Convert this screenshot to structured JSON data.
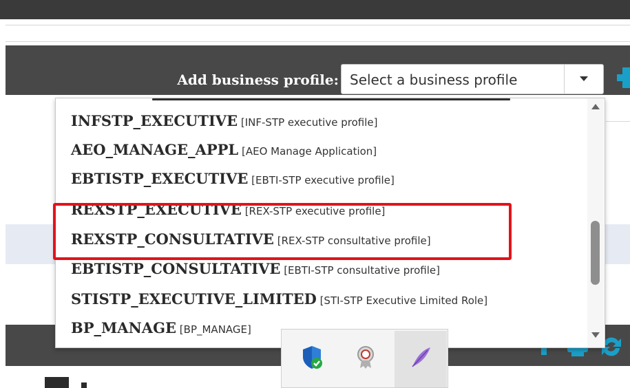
{
  "form": {
    "add_label": "Add business profile:",
    "select_placeholder": "Select a business profile"
  },
  "dropdown": {
    "options": [
      {
        "code": "INFSTP_EXECUTIVE",
        "desc": "[INF-STP executive profile]"
      },
      {
        "code": "AEO_MANAGE_APPL",
        "desc": "[AEO Manage Application]"
      },
      {
        "code": "EBTISTP_EXECUTIVE",
        "desc": "[EBTI-STP executive profile]"
      },
      {
        "code": "REXSTP_EXECUTIVE",
        "desc": "[REX-STP executive profile]"
      },
      {
        "code": "REXSTP_CONSULTATIVE",
        "desc": "[REX-STP consultative profile]"
      },
      {
        "code": "EBTISTP_CONSULTATIVE",
        "desc": "[EBTI-STP consultative profile]"
      },
      {
        "code": "STISTP_EXECUTIVE_LIMITED",
        "desc": "[STI-STP Executive Limited Role]"
      },
      {
        "code": "BP_MANAGE",
        "desc": "[BP_MANAGE]"
      }
    ],
    "highlighted_options": [
      "REXSTP_EXECUTIVE",
      "REXSTP_CONSULTATIVE"
    ]
  },
  "tray_icons": [
    "security-shield-icon",
    "certificate-badge-icon",
    "feather-quill-icon"
  ],
  "colors": {
    "header_band": "#484848",
    "highlight_border": "#e2131b",
    "accent_teal": "#1aa0c8"
  }
}
